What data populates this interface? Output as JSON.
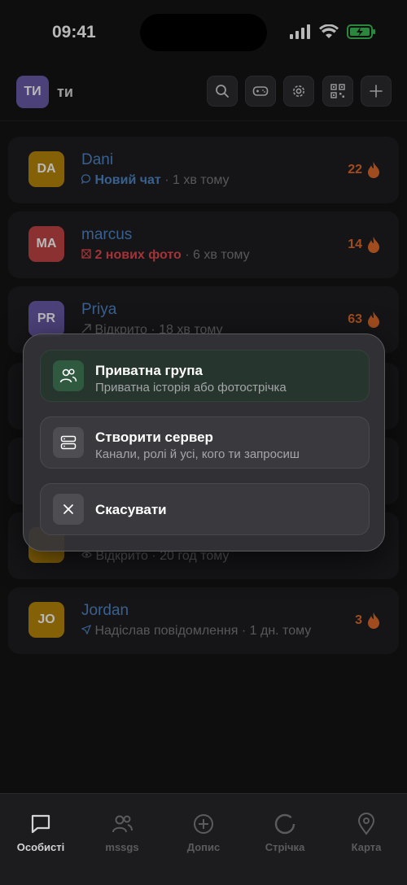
{
  "status": {
    "time": "09:41"
  },
  "header": {
    "avatar_initials": "ТИ",
    "name": "ти"
  },
  "chats": [
    {
      "initials": "DA",
      "name": "Dani",
      "status_icon": "chat-bubble-icon",
      "status": "Новий чат",
      "time": "1 хв тому",
      "score": "22",
      "avatar_color": "#b8860b",
      "status_color": "#4f86c6"
    },
    {
      "initials": "MA",
      "name": "marcus",
      "status_icon": "photo-icon",
      "status": "2 нових фото",
      "time": "6 хв тому",
      "score": "14",
      "avatar_color": "#c24444",
      "status_color": "#e0484e"
    },
    {
      "initials": "PR",
      "name": "Priya",
      "status_icon": "opened-arrow-icon",
      "status": "Відкрито",
      "time": "18 хв тому",
      "score": "63",
      "avatar_color": "#6a5aa8",
      "status_color": "#7a7a7e"
    },
    {
      "initials": "",
      "name": "",
      "status_icon": "eye-icon",
      "status": "Відкрито",
      "time": "20 год тому",
      "score": "",
      "avatar_color": "#b8860b",
      "status_color": "#7a7a7e"
    },
    {
      "initials": "JO",
      "name": "Jordan",
      "status_icon": "sent-arrow-icon",
      "status": "Надіслав повідомлення",
      "time": "1 дн. тому",
      "score": "3",
      "avatar_color": "#b8860b",
      "status_color": "#7a7a7e"
    }
  ],
  "sheet": {
    "options": [
      {
        "title": "Приватна група",
        "subtitle": "Приватна історія або фотострічка",
        "icon": "group-icon"
      },
      {
        "title": "Створити сервер",
        "subtitle": "Канали, ролі й усі, кого ти запросиш",
        "icon": "server-icon"
      },
      {
        "title": "Скасувати",
        "subtitle": "",
        "icon": "close-icon"
      }
    ]
  },
  "tabs": [
    {
      "label": "Особисті",
      "icon": "chat-icon",
      "active": true
    },
    {
      "label": "mssgs",
      "icon": "people-icon",
      "active": false
    },
    {
      "label": "Допис",
      "icon": "plus-circle-icon",
      "active": false
    },
    {
      "label": "Стрічка",
      "icon": "circle-icon",
      "active": false
    },
    {
      "label": "Карта",
      "icon": "location-pin-icon",
      "active": false
    }
  ],
  "colors": {
    "accent_blue": "#4f86c6",
    "fire": "#e06a2a",
    "new_photo_red": "#e0484e"
  }
}
